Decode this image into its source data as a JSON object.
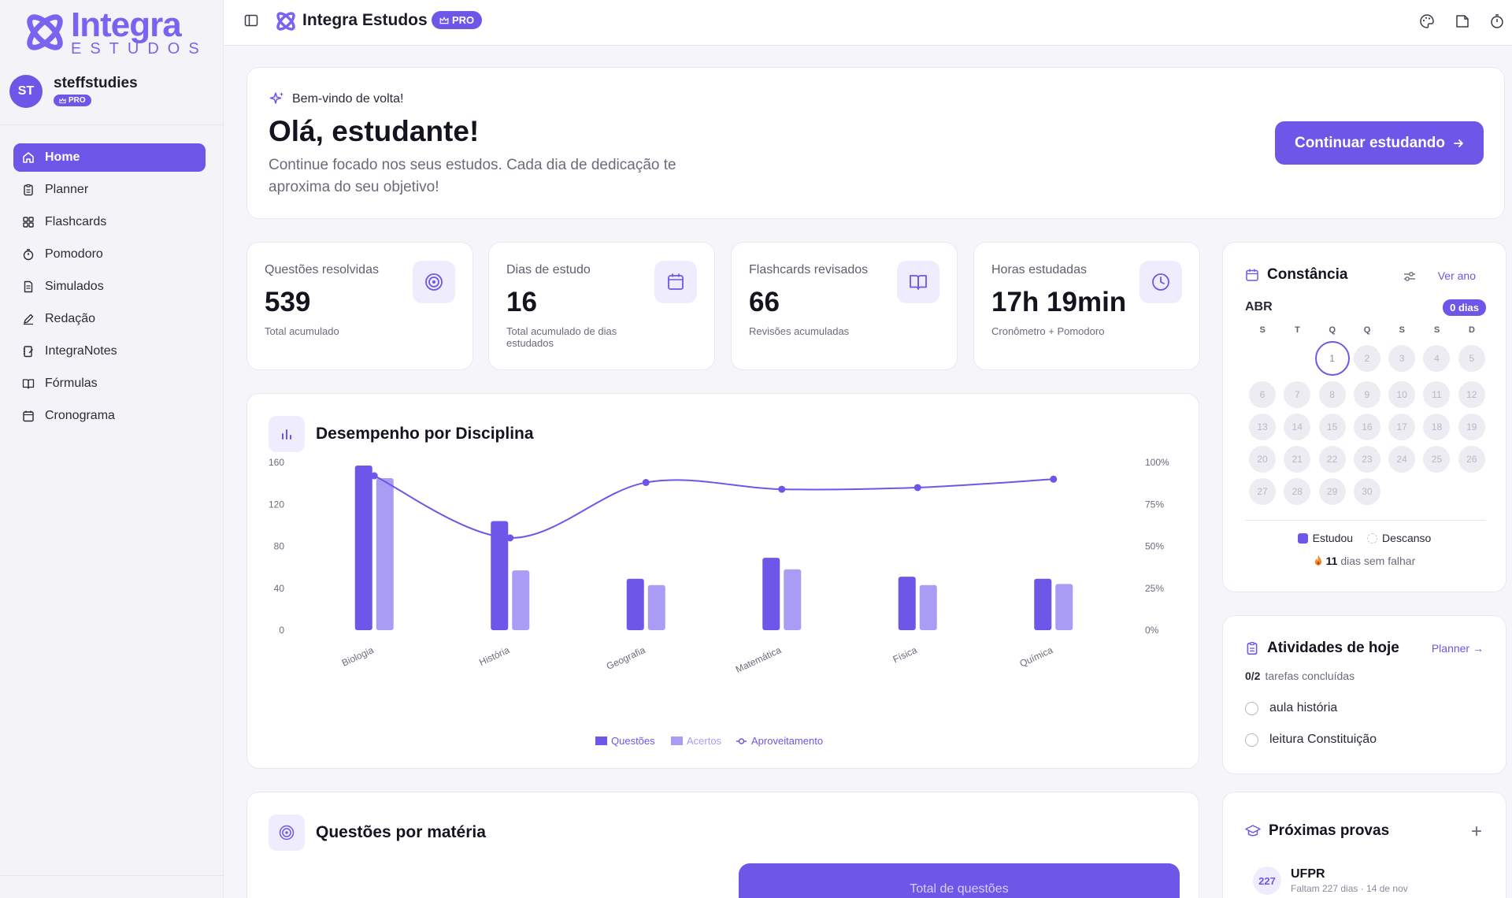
{
  "brand": {
    "name": "Integra",
    "tagline": "ESTUDOS",
    "accent": "#6e56e8"
  },
  "user": {
    "initials": "ST",
    "name": "steffstudies",
    "plan": "PRO"
  },
  "nav": {
    "items": [
      {
        "label": "Home",
        "icon": "home-icon",
        "active": true
      },
      {
        "label": "Planner",
        "icon": "clipboard-icon"
      },
      {
        "label": "Flashcards",
        "icon": "grid-icon"
      },
      {
        "label": "Pomodoro",
        "icon": "timer-icon"
      },
      {
        "label": "Simulados",
        "icon": "document-icon"
      },
      {
        "label": "Redação",
        "icon": "pen-icon"
      },
      {
        "label": "IntegraNotes",
        "icon": "notebook-icon"
      },
      {
        "label": "Fórmulas",
        "icon": "book-icon"
      },
      {
        "label": "Cronograma",
        "icon": "calendar-icon"
      }
    ]
  },
  "topbar": {
    "title": "Integra Estudos",
    "badge": "PRO"
  },
  "welcome": {
    "tag": "Bem-vindo de volta!",
    "title": "Olá, estudante!",
    "subtitle": "Continue focado nos seus estudos. Cada dia de dedicação te aproxima do seu objetivo!",
    "cta": "Continuar estudando"
  },
  "stats": [
    {
      "label": "Questões resolvidas",
      "value": "539",
      "sub": "Total acumulado",
      "icon": "target-icon"
    },
    {
      "label": "Dias de estudo",
      "value": "16",
      "sub": "Total acumulado de dias estudados",
      "icon": "calendar-icon"
    },
    {
      "label": "Flashcards revisados",
      "value": "66",
      "sub": "Revisões acumuladas",
      "icon": "book-open-icon"
    },
    {
      "label": "Horas estudadas",
      "value": "17h 19min",
      "sub": "Cronômetro + Pomodoro",
      "icon": "clock-icon"
    }
  ],
  "performance": {
    "title": "Desempenho por Disciplina",
    "legend": {
      "questions": "Questões",
      "hits": "Acertos",
      "rate": "Aproveitamento"
    }
  },
  "chart_data": {
    "type": "bar",
    "title": "Desempenho por Disciplina",
    "categories": [
      "Biologia",
      "História",
      "Geografia",
      "Matemática",
      "Física",
      "Química"
    ],
    "series": [
      {
        "name": "Questões",
        "type": "bar",
        "axis": "left",
        "values": [
          157,
          104,
          49,
          69,
          51,
          49
        ],
        "color": "#6e56e8"
      },
      {
        "name": "Acertos",
        "type": "bar",
        "axis": "left",
        "values": [
          145,
          57,
          43,
          58,
          43,
          44
        ],
        "color": "#a99cf4"
      },
      {
        "name": "Aproveitamento",
        "type": "line",
        "axis": "right",
        "values": [
          92,
          55,
          88,
          84,
          85,
          90
        ],
        "color": "#6e56e8"
      }
    ],
    "y_left": {
      "ticks": [
        "160",
        "120",
        "80",
        "40",
        "0"
      ],
      "range": [
        0,
        160
      ]
    },
    "y_right": {
      "ticks": [
        "100%",
        "75%",
        "50%",
        "25%",
        "0%"
      ],
      "range": [
        0,
        100
      ]
    },
    "legend_position": "bottom"
  },
  "questions_card": {
    "title": "Questões por matéria",
    "bar_label": "Total de questões"
  },
  "calendar": {
    "title": "Constância",
    "link": "Ver ano",
    "month": "ABR",
    "streak_badge": "0 dias",
    "weekdays": [
      "S",
      "T",
      "Q",
      "Q",
      "S",
      "S",
      "D"
    ],
    "offset": 2,
    "days": [
      "1",
      "2",
      "3",
      "4",
      "5",
      "6",
      "7",
      "8",
      "9",
      "10",
      "11",
      "12",
      "13",
      "14",
      "15",
      "16",
      "17",
      "18",
      "19",
      "20",
      "21",
      "22",
      "23",
      "24",
      "25",
      "26",
      "27",
      "28",
      "29",
      "30"
    ],
    "today": "1",
    "legend": {
      "studied": "Estudou",
      "rest": "Descanso"
    },
    "streak": {
      "count": "11",
      "label": "dias sem falhar"
    }
  },
  "activities": {
    "title": "Atividades de hoje",
    "link": "Planner",
    "count": "0/2",
    "count_label": "tarefas concluídas",
    "items": [
      "aula história",
      "leitura Constituição"
    ]
  },
  "exams": {
    "title": "Próximas provas",
    "add": "+",
    "items": [
      {
        "badge": "227",
        "name": "UFPR",
        "sub": "Faltam 227 dias · 14 de nov"
      }
    ]
  }
}
